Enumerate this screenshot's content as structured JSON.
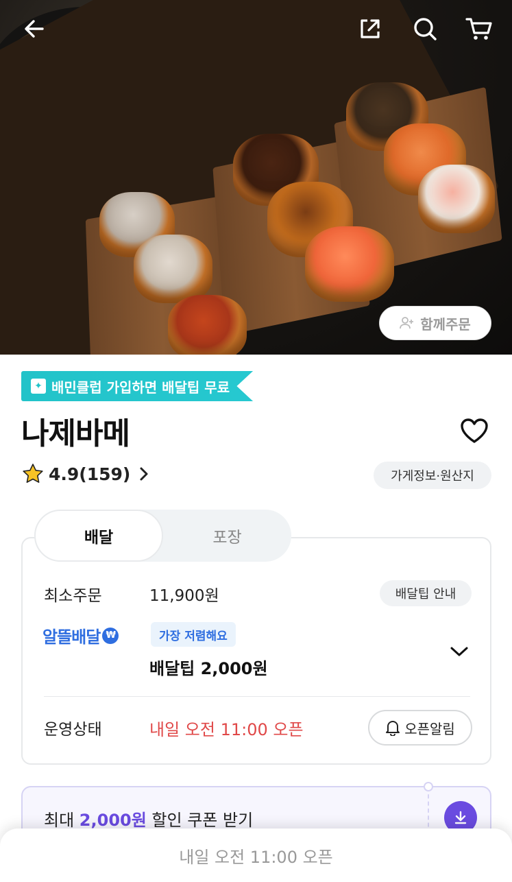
{
  "hero": {
    "share_order_label": "함께주문",
    "icons": [
      "back-arrow-icon",
      "share-icon",
      "search-icon",
      "cart-icon"
    ]
  },
  "club_badge": {
    "label": "배민클럽 가입하면 배달팁 무료",
    "color": "#22c3c9"
  },
  "store": {
    "name": "나제바메",
    "rating": "4.9",
    "review_count": "(159)",
    "info_label": "가게정보·원산지"
  },
  "tabs": {
    "delivery": "배달",
    "pickup": "포장"
  },
  "delivery": {
    "min_order_label": "최소주문",
    "min_order_value": "11,900원",
    "tip_info_label": "배달팁 안내",
    "altteul_label": "알뜰배달",
    "cheapest_label": "가장 저렴해요",
    "tip_value": "배달팁 2,000원",
    "status_label": "운영상태",
    "status_value": "내일 오전 11:00 오픈",
    "alarm_label": "오픈알림"
  },
  "coupon": {
    "prefix": "최대 ",
    "amount": "2,000원",
    "suffix": " 할인 쿠폰 받기",
    "accent": "#6a4be0"
  },
  "bottom_bar": {
    "label": "내일 오전 11:00 오픈"
  }
}
